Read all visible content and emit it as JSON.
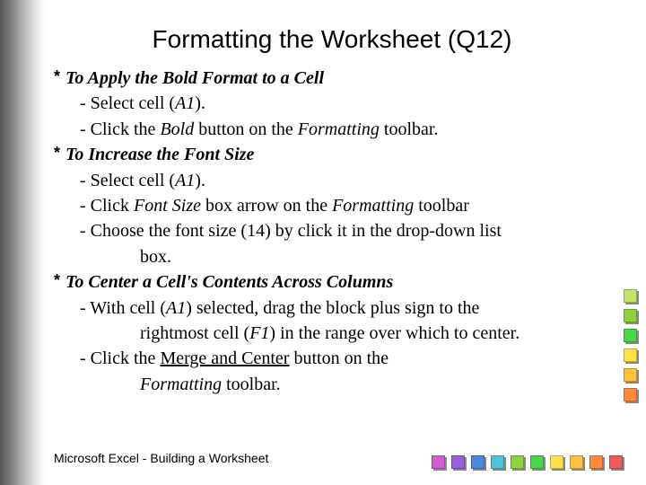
{
  "title": "Formatting the Worksheet (Q12)",
  "sections": [
    {
      "heading": "To Apply the Bold Format to a Cell",
      "steps": [
        {
          "segments": [
            {
              "t": "- Select cell ("
            },
            {
              "t": "A1",
              "cls": "i"
            },
            {
              "t": ")."
            }
          ]
        },
        {
          "segments": [
            {
              "t": "- Click the "
            },
            {
              "t": "Bold",
              "cls": "i"
            },
            {
              "t": " button on the "
            },
            {
              "t": "Formatting",
              "cls": "i"
            },
            {
              "t": " toolbar."
            }
          ]
        }
      ]
    },
    {
      "heading": "To Increase the Font Size",
      "steps": [
        {
          "segments": [
            {
              "t": "- Select cell ("
            },
            {
              "t": "A1",
              "cls": "i"
            },
            {
              "t": ")."
            }
          ]
        },
        {
          "segments": [
            {
              "t": "- Click "
            },
            {
              "t": "Font Size",
              "cls": "i"
            },
            {
              "t": " box arrow on the "
            },
            {
              "t": "Formatting",
              "cls": "i"
            },
            {
              "t": " toolbar"
            }
          ]
        },
        {
          "segments": [
            {
              "t": "- Choose the font size (14) by click it in the drop-down list"
            }
          ],
          "cont": [
            {
              "t": "box."
            }
          ]
        }
      ]
    },
    {
      "heading": "To Center a Cell's Contents Across Columns",
      "steps": [
        {
          "segments": [
            {
              "t": "- With cell ("
            },
            {
              "t": "A1",
              "cls": "i"
            },
            {
              "t": ") selected, drag the block plus sign to the"
            }
          ],
          "cont": [
            {
              "t": "rightmost cell ("
            },
            {
              "t": "F1",
              "cls": "i"
            },
            {
              "t": ") in the range over which to center."
            }
          ]
        },
        {
          "segments": [
            {
              "t": "- Click the "
            },
            {
              "t": "Merge and Center",
              "cls": "ul"
            },
            {
              "t": " button on the"
            }
          ],
          "cont": [
            {
              "t": "Formatting",
              "cls": "i"
            },
            {
              "t": " toolbar."
            }
          ]
        }
      ]
    }
  ],
  "footer": "Microsoft  Excel - Building a Worksheet",
  "colors_right": [
    "#c7e36a",
    "#8fd13f",
    "#4ad54a",
    "#ffe24a",
    "#ffbf3f",
    "#ff8a3a"
  ],
  "colors_bottom": [
    "#f05a5a",
    "#ff8a3a",
    "#ffbf3f",
    "#ffe24a",
    "#4ad54a",
    "#8fd13f",
    "#4fc3d9",
    "#4a88e0",
    "#9a5fe0",
    "#d15fd1"
  ]
}
